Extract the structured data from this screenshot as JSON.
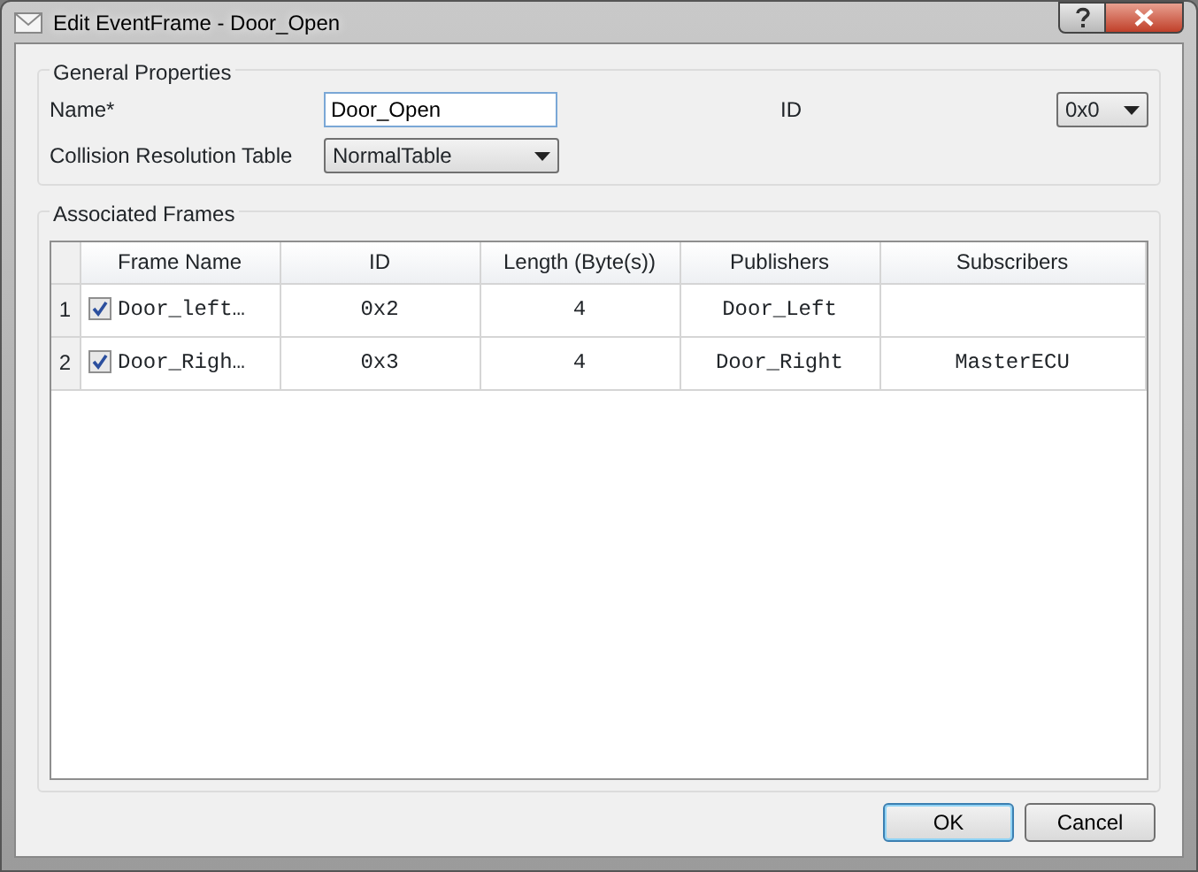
{
  "window": {
    "title": "Edit EventFrame - Door_Open"
  },
  "general_properties": {
    "title": "General Properties",
    "name_label": "Name*",
    "name_value": "Door_Open",
    "id_label": "ID",
    "id_value": "0x0",
    "collision_label": "Collision Resolution Table",
    "collision_value": "NormalTable"
  },
  "associated_frames": {
    "title": "Associated Frames",
    "columns": [
      "Frame Name",
      "ID",
      "Length (Byte(s))",
      "Publishers",
      "Subscribers"
    ],
    "rows": [
      {
        "number": "1",
        "checked": true,
        "cells": [
          "Door_left…",
          "0x2",
          "4",
          "Door_Left",
          ""
        ]
      },
      {
        "number": "2",
        "checked": true,
        "cells": [
          "Door_Righ…",
          "0x3",
          "4",
          "Door_Right",
          "MasterECU"
        ]
      }
    ]
  },
  "buttons": [
    {
      "label": "OK",
      "default": true
    },
    {
      "label": "Cancel",
      "default": false
    }
  ]
}
